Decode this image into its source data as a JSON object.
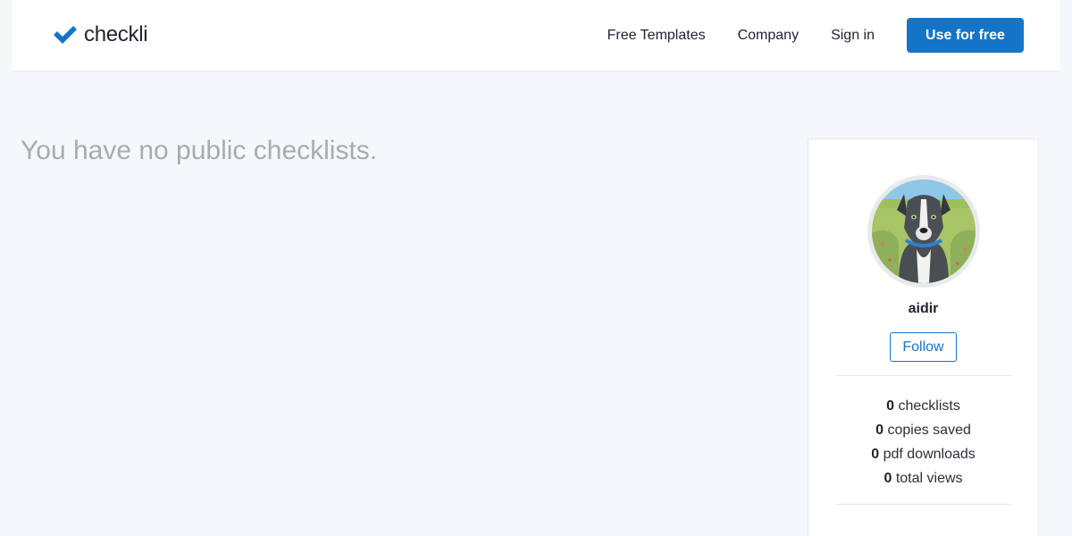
{
  "brand": {
    "name": "checkli",
    "accent": "#1475c8"
  },
  "nav": {
    "links": [
      "Free Templates",
      "Company",
      "Sign in"
    ],
    "cta": "Use for free"
  },
  "main": {
    "empty_message": "You have no public checklists."
  },
  "profile": {
    "username": "aidir",
    "follow_label": "Follow",
    "stats": [
      {
        "count": "0",
        "label": "checklists"
      },
      {
        "count": "0",
        "label": "copies saved"
      },
      {
        "count": "0",
        "label": "pdf downloads"
      },
      {
        "count": "0",
        "label": "total views"
      }
    ]
  }
}
